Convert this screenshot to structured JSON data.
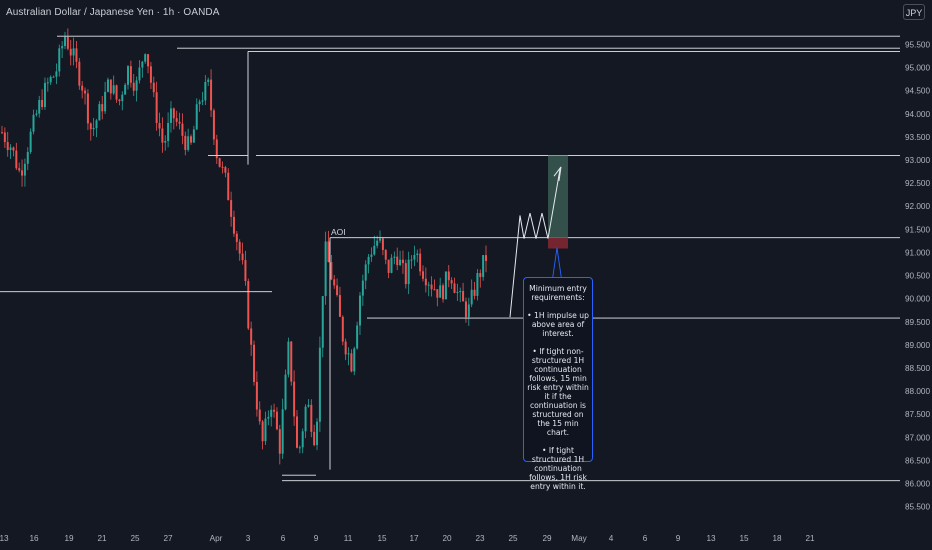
{
  "header": {
    "title": "Australian Dollar / Japanese Yen · 1h · OANDA",
    "currency_button": "JPY"
  },
  "colors": {
    "background": "#141823",
    "up": "#26a69a",
    "down": "#ef5350",
    "line": "#e6e8ee",
    "text": "#b2b5be",
    "note_border": "#2962ff",
    "target_zone": "#3a5a52",
    "stop_zone": "#7a2630"
  },
  "annotations": {
    "aoi_label": "AOI",
    "note": [
      "Minimum entry requirements:",
      "• 1H impulse up above area of interest.",
      "• If tight non-structured 1H continuation follows, 15 min risk entry within it if the continuation is structured on the 15 min chart.",
      "• If tight structured 1H continuation follows, 1H risk entry within it."
    ]
  },
  "chart_data": {
    "type": "candlestick",
    "symbol": "AUDJPY",
    "timeframe": "1h",
    "ylim": [
      85.2,
      96.0
    ],
    "y_ticks": [
      "95.500",
      "95.000",
      "94.500",
      "94.000",
      "93.500",
      "93.000",
      "92.500",
      "92.000",
      "91.500",
      "91.000",
      "90.500",
      "90.000",
      "89.500",
      "89.000",
      "88.500",
      "88.000",
      "87.500",
      "87.000",
      "86.500",
      "86.000",
      "85.500"
    ],
    "x_ticks": [
      "13",
      "16",
      "19",
      "21",
      "25",
      "27",
      "Apr",
      "3",
      "6",
      "9",
      "11",
      "15",
      "17",
      "20",
      "23",
      "25",
      "29",
      "May",
      "4",
      "6",
      "9",
      "13",
      "15",
      "18",
      "21"
    ],
    "horizontal_levels": [
      95.68,
      95.42,
      95.35,
      93.1,
      91.32,
      90.15,
      89.58,
      86.06
    ],
    "aoi_level": 91.32,
    "trade_zone": {
      "entry": 91.32,
      "target": 93.1,
      "stop": 91.15
    },
    "price_path": [
      93.6,
      93.3,
      92.7,
      93.4,
      94.1,
      94.6,
      94.9,
      95.7,
      95.2,
      94.6,
      93.6,
      94.1,
      94.7,
      94.2,
      95.0,
      94.6,
      95.5,
      94.2,
      93.3,
      94.0,
      93.6,
      93.2,
      94.3,
      94.6,
      93.1,
      92.5,
      91.5,
      90.5,
      88.5,
      86.8,
      87.8,
      86.8,
      89.0,
      86.5,
      87.8,
      86.9,
      91.1,
      90.3,
      89.2,
      88.6,
      90.2,
      91.0,
      91.3,
      90.6,
      91.0,
      90.4,
      91.1,
      90.6,
      90.3,
      90.1,
      90.6,
      90.0,
      89.7,
      90.4,
      90.9
    ]
  }
}
